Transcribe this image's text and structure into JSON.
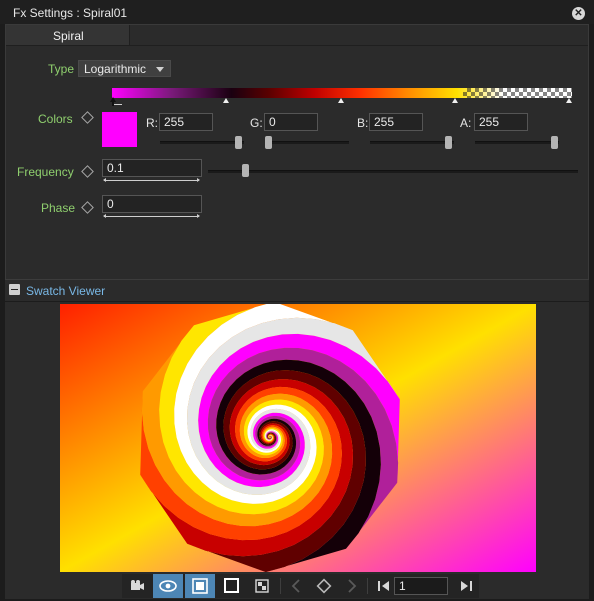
{
  "window": {
    "title": "Fx Settings : Spiral01",
    "close_icon": "close-icon"
  },
  "tabs": [
    {
      "label": "Spiral",
      "active": true
    }
  ],
  "type": {
    "label": "Type",
    "value": "Logarithmic"
  },
  "colors": {
    "label": "Colors",
    "swatch_color": "#ff00ff",
    "channels": [
      {
        "label": "R:",
        "value": "255",
        "level": 1.0
      },
      {
        "label": "G:",
        "value": "0",
        "level": 0.0
      },
      {
        "label": "B:",
        "value": "255",
        "level": 1.0
      },
      {
        "label": "A:",
        "value": "255",
        "level": 1.0
      }
    ]
  },
  "frequency": {
    "label": "Frequency",
    "value": "0.1"
  },
  "phase": {
    "label": "Phase",
    "value": "0"
  },
  "swatch_viewer": {
    "label": "Swatch Viewer"
  },
  "toolbar": {
    "frame": "1",
    "icons": [
      "camera-icon",
      "eye-icon",
      "frame-filled-icon",
      "frame-outline-icon",
      "checker-icon",
      "prev-key-icon",
      "keyframe-icon",
      "next-key-icon",
      "prev-frame-icon",
      "next-frame-icon"
    ]
  },
  "accent": "#4d86b5"
}
